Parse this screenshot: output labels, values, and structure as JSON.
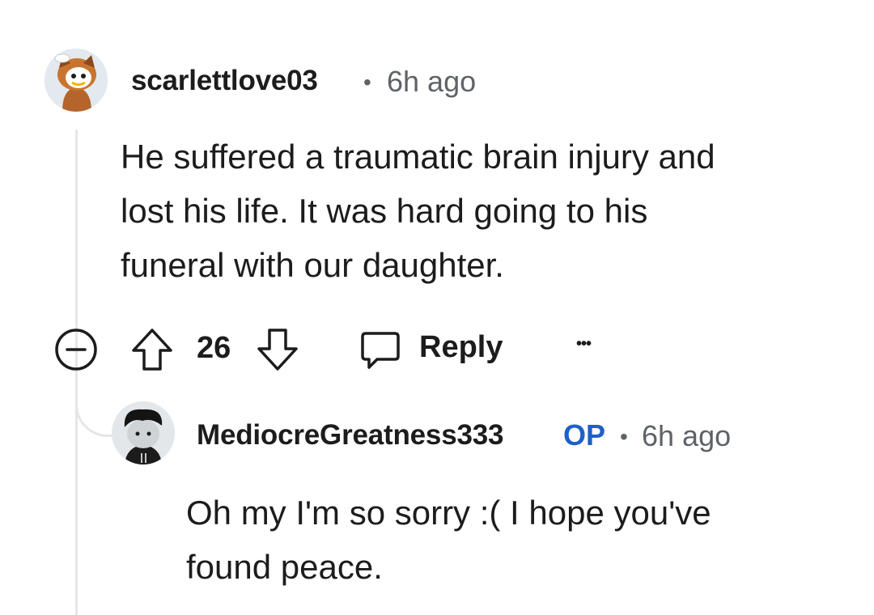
{
  "comment": {
    "username": "scarlettlove03",
    "separator": "•",
    "time_ago": "6h ago",
    "body_lines": [
      "He suffered a traumatic brain injury and",
      "lost his life. It was hard going to his",
      "funeral with our daughter."
    ],
    "vote_count": "26",
    "reply_label": "Reply",
    "more_label": "•••"
  },
  "reply": {
    "username": "MediocreGreatness333",
    "op_badge": "OP",
    "separator": "•",
    "time_ago": "6h ago",
    "body_lines": [
      "Oh my I'm so sorry :( I hope you've",
      "found peace."
    ]
  },
  "colors": {
    "text": "#1c1c1c",
    "meta": "#5f6368",
    "op_badge": "#1f5fc8",
    "thread_line": "#e6e6e6"
  },
  "icons": [
    "collapse-icon",
    "upvote-icon",
    "downvote-icon",
    "reply-icon",
    "more-icon"
  ]
}
